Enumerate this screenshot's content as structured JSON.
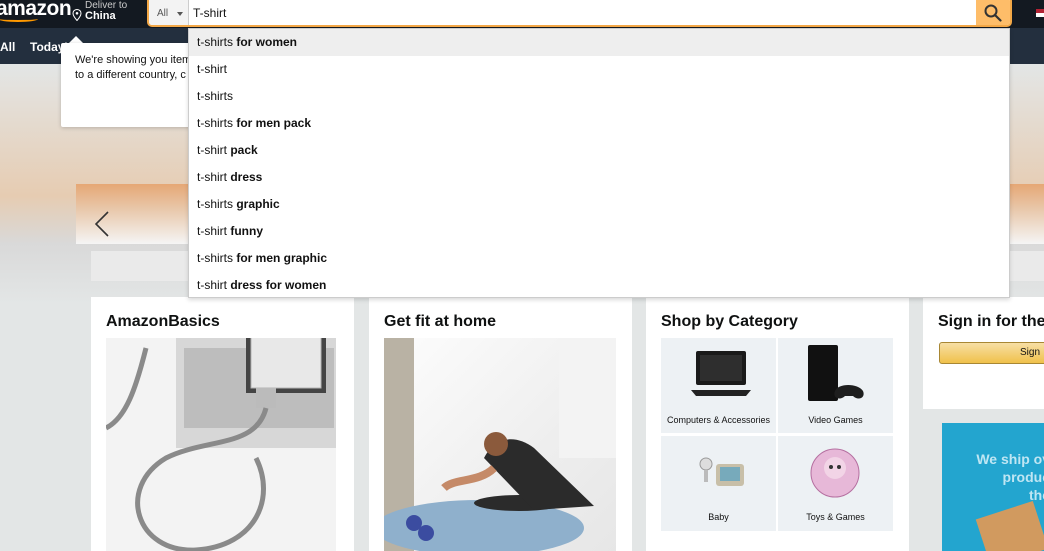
{
  "header": {
    "logo_text": "amazon",
    "deliver_line1": "Deliver to",
    "deliver_line2": "China",
    "search_category": "All",
    "search_value": "T-shirt"
  },
  "nav": {
    "all_label": "All",
    "today_label": "Today'"
  },
  "tooltip": {
    "line1": "We're showing you item",
    "line2": "to a different country, c"
  },
  "suggestions": [
    {
      "prefix": "t-shirt",
      "suffix_plain": "s",
      "suffix_bold": " for women"
    },
    {
      "prefix": "t-shirt",
      "suffix_plain": "",
      "suffix_bold": ""
    },
    {
      "prefix": "t-shirt",
      "suffix_plain": "s",
      "suffix_bold": ""
    },
    {
      "prefix": "t-shirt",
      "suffix_plain": "s",
      "suffix_bold": " for men pack"
    },
    {
      "prefix": "t-shirt",
      "suffix_plain": "",
      "suffix_bold": " pack"
    },
    {
      "prefix": "t-shirt",
      "suffix_plain": "",
      "suffix_bold": " dress"
    },
    {
      "prefix": "t-shirt",
      "suffix_plain": "s",
      "suffix_bold": " graphic"
    },
    {
      "prefix": "t-shirt",
      "suffix_plain": "",
      "suffix_bold": " funny"
    },
    {
      "prefix": "t-shirt",
      "suffix_plain": "s",
      "suffix_bold": " for men graphic"
    },
    {
      "prefix": "t-shirt",
      "suffix_plain": "",
      "suffix_bold": " dress for women"
    }
  ],
  "cards": {
    "basics_title": "AmazonBasics",
    "fit_title": "Get fit at home",
    "category_title": "Shop by Category",
    "signin_title": "Sign in for the",
    "signin_button": "Sign",
    "categories": [
      {
        "label": "Computers & Accessories"
      },
      {
        "label": "Video Games"
      },
      {
        "label": "Baby"
      },
      {
        "label": "Toys & Games"
      }
    ],
    "ship_line1": "We ship ov",
    "ship_line2": "produc",
    "ship_line3": "the"
  },
  "colors": {
    "nav_dark": "#131921",
    "nav_secondary": "#232f3e",
    "search_button": "#febd69",
    "search_border": "#f3a847",
    "ship_banner": "#23a5cf"
  }
}
